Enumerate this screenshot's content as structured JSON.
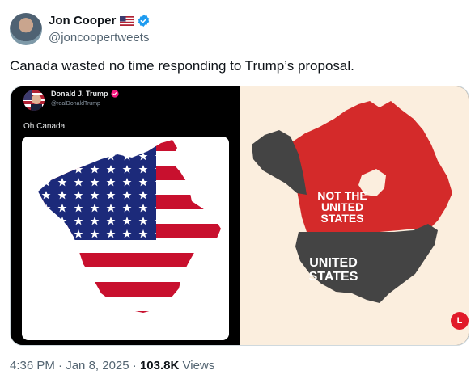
{
  "tweet": {
    "author": {
      "display_name": "Jon Cooper",
      "handle": "@joncoopertweets",
      "flag_icon": "us-flag-icon",
      "verified_icon": "verified-badge-icon",
      "verified_color": "#1d9bf0"
    },
    "text": "Canada wasted no time responding to Trump’s proposal.",
    "time": "4:36 PM",
    "sep1": " · ",
    "date": "Jan 8, 2025",
    "sep2": " · ",
    "views_count": "103.8K",
    "views_label": " Views"
  },
  "media": {
    "left": {
      "author_name": "Donald J. Trump",
      "author_handle": "@realDonaldTrump",
      "badge_color": "#f91880",
      "text": "Oh Canada!",
      "image": "north-america-us-flag-map"
    },
    "right": {
      "image": "canada-us-map",
      "top_label_lines": [
        "NOT THE",
        "UNITED",
        "STATES"
      ],
      "bottom_label_lines": [
        "UNITED",
        "STATES"
      ],
      "red_color": "#d42a2a",
      "gray_color": "#444444",
      "background": "#fbeede"
    }
  }
}
